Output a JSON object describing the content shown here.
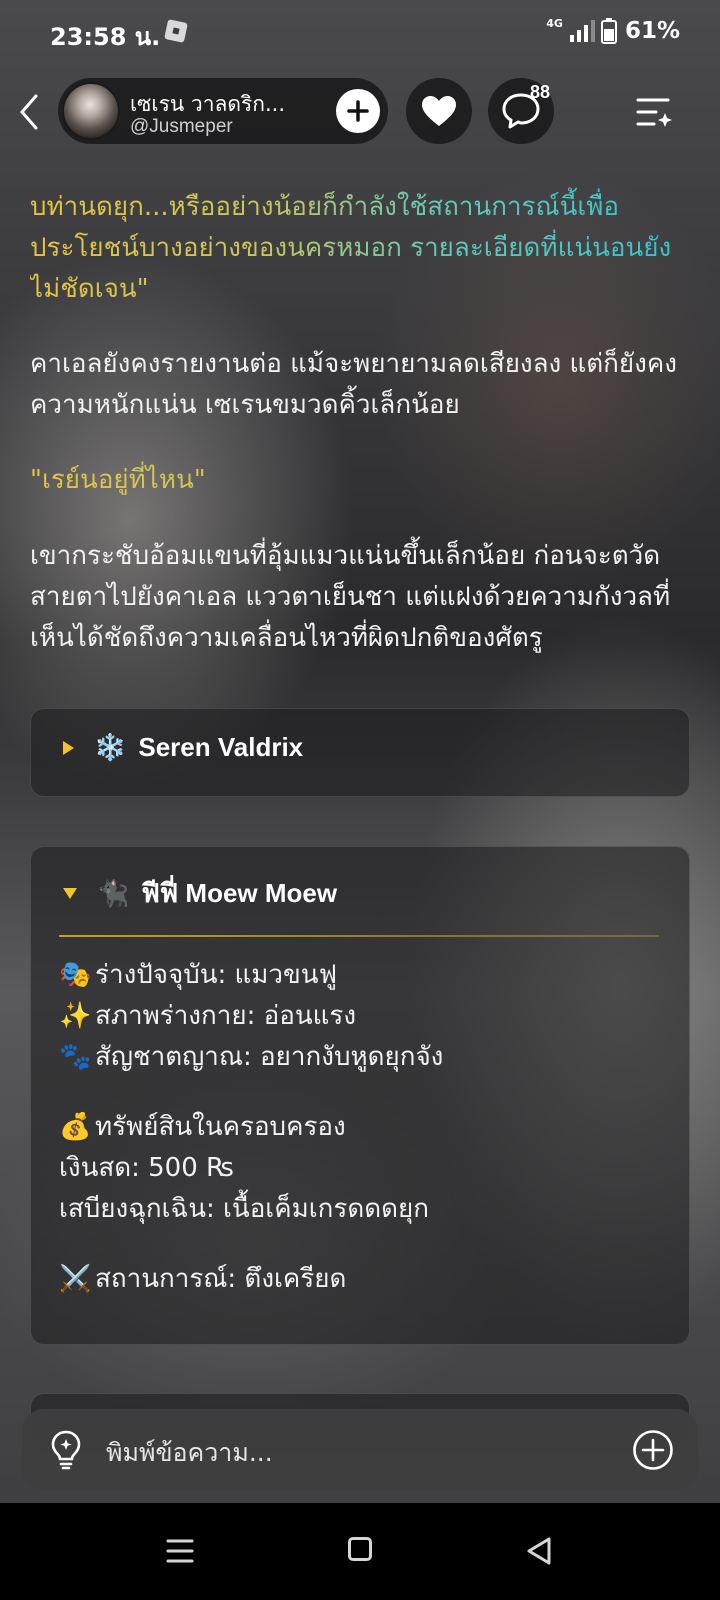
{
  "status_bar": {
    "time": "23:58 น.",
    "network": "4G",
    "battery": "61%"
  },
  "header": {
    "name": "เซเรน วาลดริก...",
    "handle": "@Jusmeper",
    "comment_count": "88"
  },
  "story": {
    "p1": "บท่านดยุก...หรืออย่างน้อยก็กำลังใช้สถานการณ์นี้เพื่อประโยชน์บางอย่างของนครหมอก รายละเอียดที่แน่นอนยังไม่ชัดเจน\"",
    "p2": "คาเอลยังคงรายงานต่อ แม้จะพยายามลดเสียงลง แต่ก็ยังคงความหนักแน่น เซเรนขมวดคิ้วเล็กน้อย",
    "p3": "\"เรย์นอยู่ที่ไหน\"",
    "p4": "เขากระชับอ้อมแขนที่อุ้มแมวแน่นขึ้นเล็กน้อย ก่อนจะตวัดสายตาไปยังคาเอล แววตาเย็นชา แต่แฝงด้วยความกังวลที่เห็นได้ชัดถึงความเคลื่อนไหวที่ผิดปกติของศัตรู"
  },
  "card_seren": {
    "emoji": "❄️",
    "title": "Seren Valdrix"
  },
  "card_fifi": {
    "emoji": "🐈‍⬛",
    "title": "ฟีฟี่ Moew Moew",
    "form_emoji": "🎭",
    "form": "ร่างปัจจุบัน: แมวขนฟู",
    "body_emoji": "✨",
    "body_state": "สภาพร่างกาย: อ่อนแรง",
    "instinct_emoji": "🐾",
    "instinct": "สัญชาตญาณ: อยากงับหูดยุกจัง",
    "assets_emoji": "💰",
    "assets_title": "ทรัพย์สินในครอบครอง",
    "cash": "เงินสด: 500 ₨",
    "emergency": "เสบียงฉุกเฉิน: เนื้อเค็มเกรดดดยุก",
    "situation_emoji": "⚔️",
    "situation": "สถานการณ์: ตึงเครียด"
  },
  "input": {
    "placeholder": "พิมพ์ข้อความ..."
  },
  "colors": {
    "accent_gold": "#f2c230",
    "gradient_start": "#e6c443",
    "gradient_end": "#2fc3cf"
  },
  "icons": [
    "back-icon",
    "plus-icon",
    "heart-icon",
    "comment-icon",
    "menu-sparkle-icon",
    "lightbulb-icon",
    "add-circle-icon"
  ]
}
